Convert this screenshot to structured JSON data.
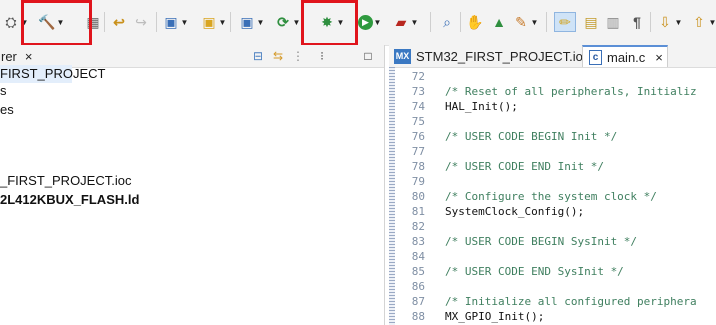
{
  "toolbar": {
    "items": [
      {
        "name": "repeat-button",
        "icon": "⛭"
      },
      {
        "name": "build-hammer",
        "icon": "🔨"
      },
      {
        "name": "build-all",
        "icon": "▦"
      },
      {
        "name": "undo",
        "icon": "↩"
      },
      {
        "name": "redo",
        "icon": "↪"
      },
      {
        "name": "new-c-project",
        "icon": "▣"
      },
      {
        "name": "new-source-folder",
        "icon": "▣"
      },
      {
        "name": "new-class",
        "icon": "▣"
      },
      {
        "name": "refresh",
        "icon": "⟳"
      },
      {
        "name": "debug",
        "icon": "✸"
      },
      {
        "name": "run",
        "icon": "▶"
      },
      {
        "name": "external-tools",
        "icon": "▰"
      },
      {
        "name": "search",
        "icon": "⌕"
      },
      {
        "name": "open-element",
        "icon": "✋"
      },
      {
        "name": "open-perspective",
        "icon": "▲"
      },
      {
        "name": "wrench",
        "icon": "✎"
      },
      {
        "name": "highlight",
        "icon": "✏"
      },
      {
        "name": "toggle-mark",
        "icon": "▤"
      },
      {
        "name": "block-select",
        "icon": "▥"
      },
      {
        "name": "show-whitespace",
        "icon": "¶"
      },
      {
        "name": "next-annotation",
        "icon": "⇩"
      },
      {
        "name": "prev-annotation",
        "icon": "⇧"
      }
    ]
  },
  "left_view": {
    "tab_label": "rer",
    "close_symbol": "×",
    "tree": [
      "FIRST_PROJECT",
      "s",
      "es",
      "_FIRST_PROJECT.ioc",
      "2L412KBUX_FLASH.ld"
    ]
  },
  "editor": {
    "tabs": [
      {
        "badge": "MX",
        "label": "STM32_FIRST_PROJECT.ioc"
      },
      {
        "badge": "c",
        "label": "main.c",
        "close": "×"
      }
    ],
    "lines": [
      {
        "num": "72",
        "text": "",
        "kind": "code"
      },
      {
        "num": "73",
        "text": "/* Reset of all peripherals, Initializ",
        "kind": "comment"
      },
      {
        "num": "74",
        "text": "HAL_Init();",
        "kind": "code"
      },
      {
        "num": "75",
        "text": "",
        "kind": "code"
      },
      {
        "num": "76",
        "text": "/* USER CODE BEGIN Init */",
        "kind": "comment"
      },
      {
        "num": "77",
        "text": "",
        "kind": "code"
      },
      {
        "num": "78",
        "text": "/* USER CODE END Init */",
        "kind": "comment"
      },
      {
        "num": "79",
        "text": "",
        "kind": "code"
      },
      {
        "num": "80",
        "text": "/* Configure the system clock */",
        "kind": "comment"
      },
      {
        "num": "81",
        "text": "SystemClock_Config();",
        "kind": "code"
      },
      {
        "num": "82",
        "text": "",
        "kind": "code"
      },
      {
        "num": "83",
        "text": "/* USER CODE BEGIN SysInit */",
        "kind": "comment"
      },
      {
        "num": "84",
        "text": "",
        "kind": "code"
      },
      {
        "num": "85",
        "text": "/* USER CODE END SysInit */",
        "kind": "comment"
      },
      {
        "num": "86",
        "text": "",
        "kind": "code"
      },
      {
        "num": "87",
        "text": "/* Initialize all configured periphera",
        "kind": "comment"
      },
      {
        "num": "88",
        "text": "MX_GPIO_Init();",
        "kind": "code"
      }
    ]
  },
  "colors": {
    "highlight_box": "#e0141c",
    "comment": "#3f7f5f",
    "line_number": "#7f8fa4",
    "selection": "#e3eefb"
  }
}
